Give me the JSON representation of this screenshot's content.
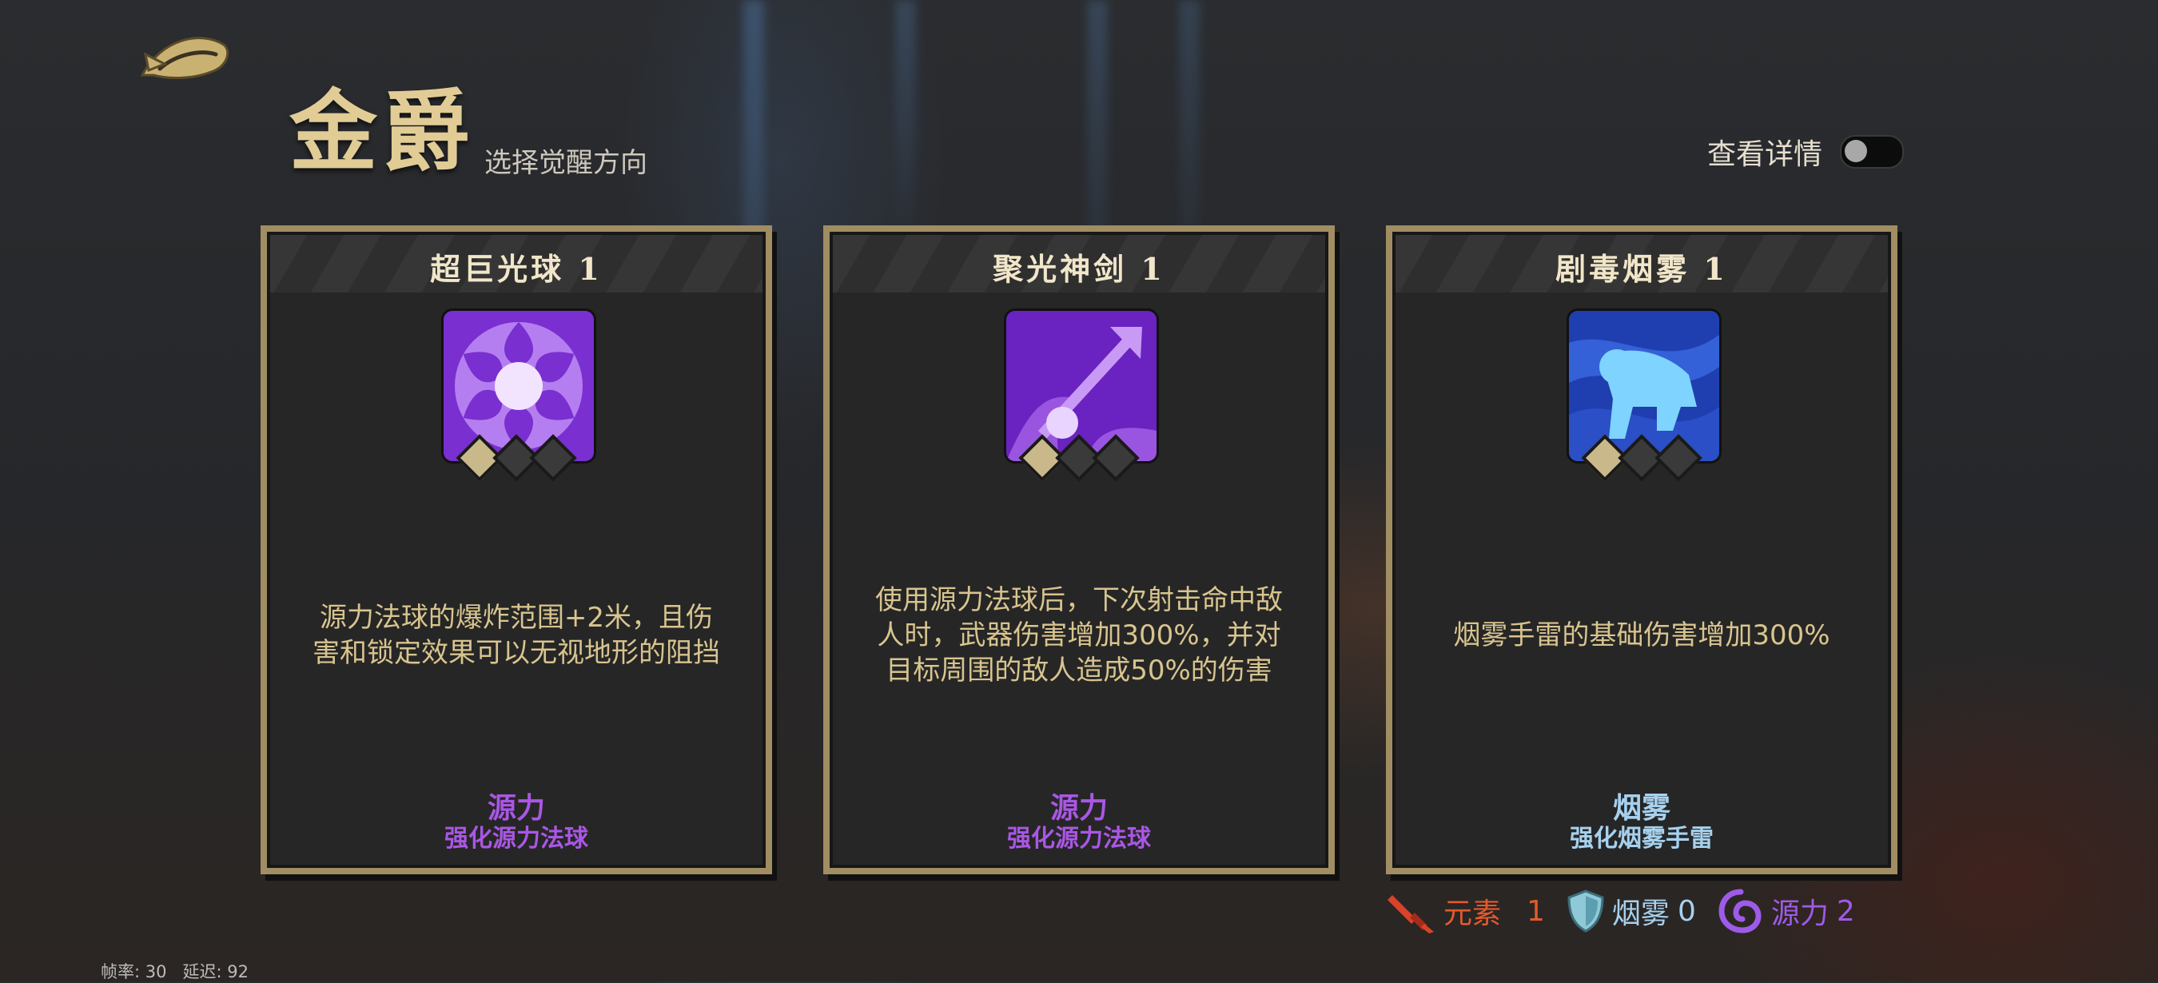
{
  "header": {
    "title": "金爵",
    "subtitle": "选择觉醒方向",
    "details_label": "查看详情",
    "details_toggle_on": false
  },
  "cards": [
    {
      "name": "超巨光球",
      "level": "1",
      "description": "源力法球的爆炸范围+2米，且伤害和锁定效果可以无视地形的阻挡",
      "category": "源力",
      "subtitle": "强化源力法球",
      "icon": "sun-burst-icon",
      "filled_gems": 1
    },
    {
      "name": "聚光神剑",
      "level": "1",
      "description": "使用源力法球后，下次射击命中敌人时，武器伤害增加300%，并对目标周围的敌人造成50%的伤害",
      "category": "源力",
      "subtitle": "强化源力法球",
      "icon": "light-sword-icon",
      "filled_gems": 1
    },
    {
      "name": "剧毒烟雾",
      "level": "1",
      "description": "烟雾手雷的基础伤害增加300%",
      "category": "烟雾",
      "subtitle": "强化烟雾手雷",
      "icon": "toxic-smoke-icon",
      "filled_gems": 1
    }
  ],
  "stats": {
    "element": {
      "label": "元素",
      "value": "1"
    },
    "smoke": {
      "label": "烟雾",
      "value": "0"
    },
    "source": {
      "label": "源力",
      "value": "2"
    }
  },
  "perf": {
    "fps_label": "帧率: 30",
    "latency_label": "延迟: 92"
  },
  "colors": {
    "gold_frame": "#a08d62",
    "purple_category": "#a957e4",
    "blue_category": "#a6d1ef",
    "element_orange": "#e25a2c"
  }
}
